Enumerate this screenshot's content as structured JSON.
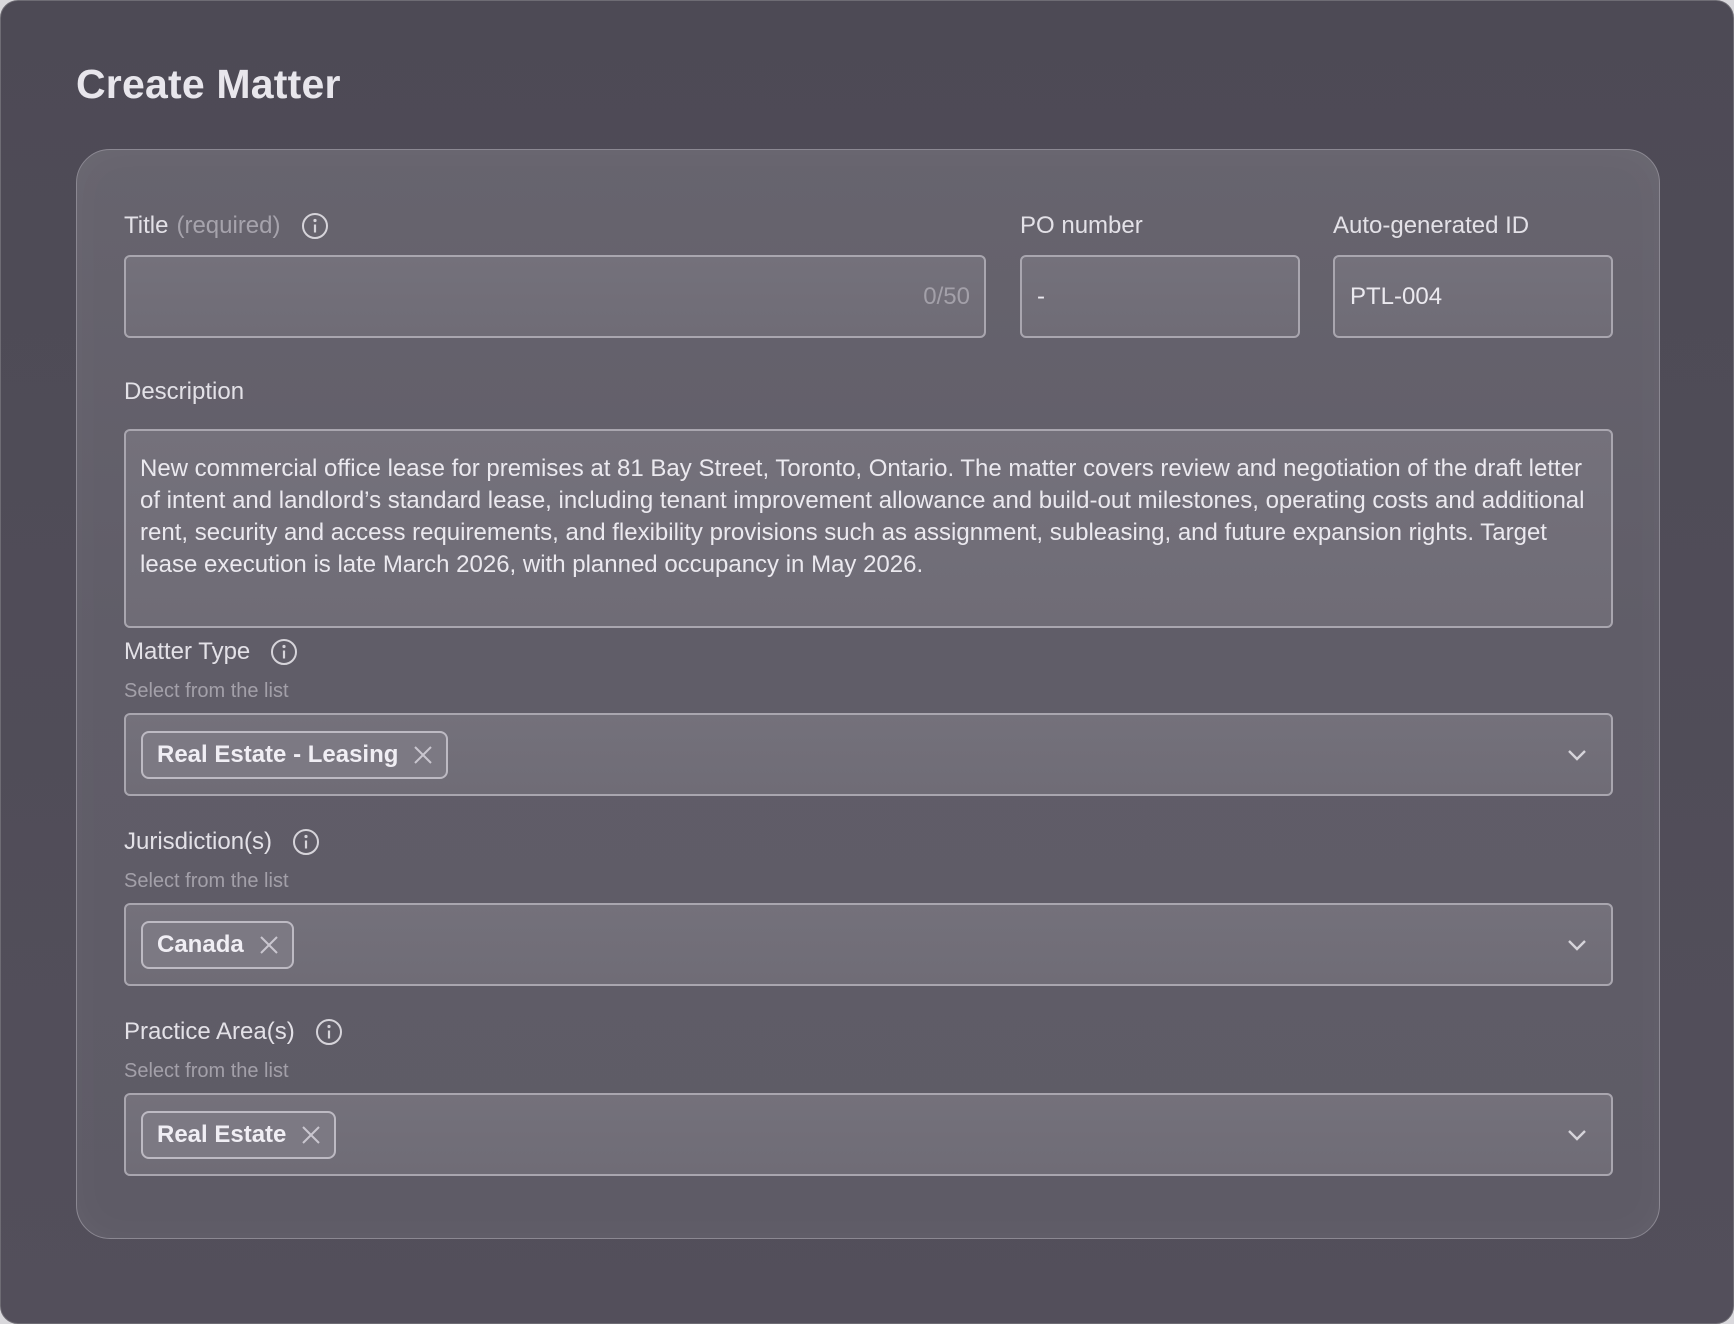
{
  "page": {
    "title": "Create Matter"
  },
  "title_field": {
    "label": "Title",
    "required_hint": "(required)",
    "value": "",
    "counter": "0/50"
  },
  "po_field": {
    "label": "PO number",
    "value": "-"
  },
  "id_field": {
    "label": "Auto-generated ID",
    "value": "PTL-004"
  },
  "description": {
    "label": "Description",
    "value": "New commercial office lease for premises at 81 Bay Street, Toronto, Ontario. The matter covers review and negotiation of the draft letter of intent and landlord’s standard lease, including tenant improvement allowance and build-out milestones, operating costs and additional rent, security and access requirements, and flexibility provisions such as assignment, subleasing, and future expansion rights. Target lease execution is late March 2026, with planned occupancy in May 2026."
  },
  "matter_type": {
    "label": "Matter Type",
    "hint": "Select from the list",
    "selected": "Real Estate - Leasing"
  },
  "jurisdictions": {
    "label": "Jurisdiction(s)",
    "hint": "Select from the list",
    "selected": "Canada"
  },
  "practice_areas": {
    "label": "Practice Area(s)",
    "hint": "Select from the list",
    "selected": "Real Estate"
  },
  "icons": {
    "info": "info-icon",
    "remove": "close-icon",
    "dropdown": "chevron-down-icon"
  }
}
